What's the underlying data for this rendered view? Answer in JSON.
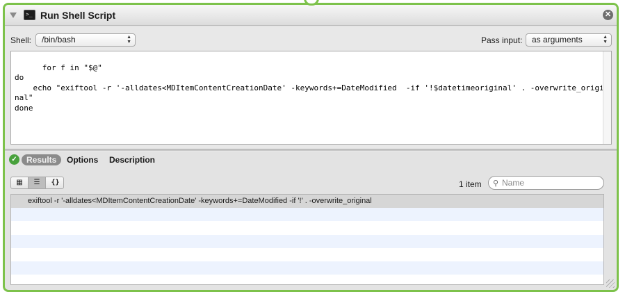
{
  "action": {
    "title": "Run Shell Script",
    "close_glyph": "✕"
  },
  "config": {
    "shell_label": "Shell:",
    "shell_value": "/bin/bash",
    "pass_label": "Pass input:",
    "pass_value": "as arguments"
  },
  "script": "for f in \"$@\"\ndo\n    echo \"exiftool -r '-alldates<MDItemContentCreationDate' -keywords+=DateModified  -if '!$datetimeoriginal' . -overwrite_original\"\ndone",
  "tabs": {
    "results": "Results",
    "options": "Options",
    "description": "Description"
  },
  "view_buttons": {
    "icon_view": "▦",
    "list_view": "☰",
    "code_view": "{}"
  },
  "results": {
    "count": "1 item",
    "search_placeholder": "Name",
    "rows": [
      "exiftool -r '-alldates<MDItemContentCreationDate' -keywords+=DateModified  -if '!' . -overwrite_original"
    ]
  },
  "colors": {
    "frame_accent": "#7dc24b",
    "success": "#48a13c"
  }
}
